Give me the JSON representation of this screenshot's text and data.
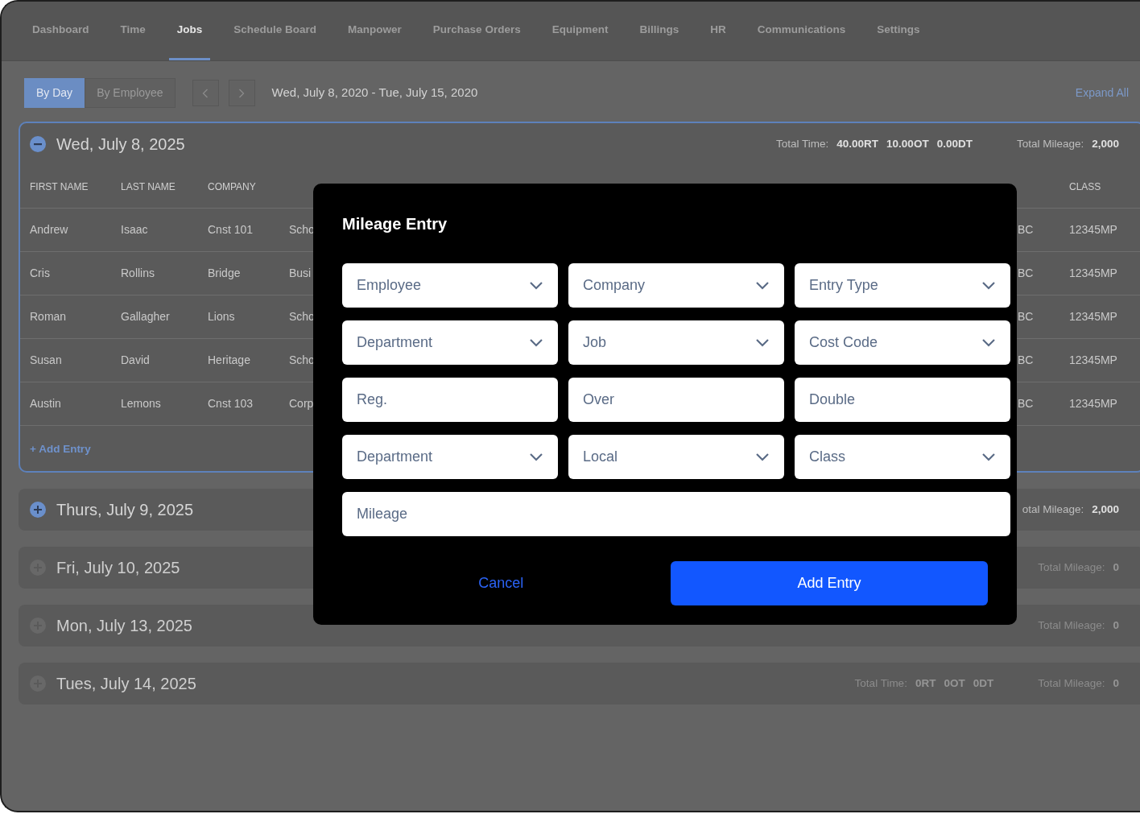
{
  "nav": [
    {
      "label": "Dashboard",
      "selected": false
    },
    {
      "label": "Time",
      "selected": false
    },
    {
      "label": "Jobs",
      "selected": true
    },
    {
      "label": "Schedule Board",
      "selected": false
    },
    {
      "label": "Manpower",
      "selected": false
    },
    {
      "label": "Purchase Orders",
      "selected": false
    },
    {
      "label": "Equipment",
      "selected": false
    },
    {
      "label": "Billings",
      "selected": false
    },
    {
      "label": "HR",
      "selected": false
    },
    {
      "label": "Communications",
      "selected": false
    },
    {
      "label": "Settings",
      "selected": false
    }
  ],
  "toolbar": {
    "views": [
      {
        "label": "By Day",
        "selected": true
      },
      {
        "label": "By Employee",
        "selected": false
      }
    ],
    "date_range": "Wed, July 8, 2020 - Tue, July 15, 2020",
    "expand_all": "Expand All"
  },
  "days": [
    {
      "title": "Wed, July 8, 2025",
      "expanded": true,
      "has_entries": true,
      "total_time": {
        "label": "Total Time:",
        "values": [
          "40.00RT",
          "10.00OT",
          "0.00DT"
        ]
      },
      "total_mileage": {
        "label": "Total Mileage:",
        "value": "2,000"
      },
      "columns": [
        "FIRST NAME",
        "LAST NAME",
        "COMPANY",
        "",
        "",
        "CLASS"
      ],
      "rows": [
        [
          "Andrew",
          "Isaac",
          "Cnst 101",
          "Scho",
          "BC",
          "12345MP"
        ],
        [
          "Cris",
          "Rollins",
          "Bridge",
          "Busi",
          "BC",
          "12345MP"
        ],
        [
          "Roman",
          "Gallagher",
          "Lions",
          "Scho",
          "BC",
          "12345MP"
        ],
        [
          "Susan",
          "David",
          "Heritage",
          "Scho",
          "BC",
          "12345MP"
        ],
        [
          "Austin",
          "Lemons",
          "Cnst 103",
          "Corp",
          "BC",
          "12345MP"
        ]
      ],
      "add_entry": "+ Add Entry"
    },
    {
      "title": "Thurs, July 9, 2025",
      "expanded": false,
      "has_entries": true,
      "total_mileage": {
        "label": "otal Mileage:",
        "value": "2,000"
      }
    },
    {
      "title": "Fri, July 10, 2025",
      "expanded": false,
      "has_entries": false,
      "total_mileage": {
        "label": "Total Mileage:",
        "value": "0"
      }
    },
    {
      "title": "Mon, July 13, 2025",
      "expanded": false,
      "has_entries": false,
      "total_mileage": {
        "label": "Total Mileage:",
        "value": "0"
      }
    },
    {
      "title": "Tues, July 14, 2025",
      "expanded": false,
      "has_entries": false,
      "total_time": {
        "label": "Total Time:",
        "values": [
          "0RT",
          "0OT",
          "0DT"
        ]
      },
      "total_mileage": {
        "label": "Total Mileage:",
        "value": "0"
      }
    }
  ],
  "modal": {
    "title": "Mileage Entry",
    "fields": [
      {
        "kind": "select",
        "placeholder": "Employee",
        "full_width": false
      },
      {
        "kind": "select",
        "placeholder": "Company",
        "full_width": false
      },
      {
        "kind": "select",
        "placeholder": "Entry Type",
        "full_width": false
      },
      {
        "kind": "select",
        "placeholder": "Department",
        "full_width": false
      },
      {
        "kind": "select",
        "placeholder": "Job",
        "full_width": false
      },
      {
        "kind": "select",
        "placeholder": "Cost Code",
        "full_width": false
      },
      {
        "kind": "text",
        "placeholder": "Reg.",
        "full_width": false
      },
      {
        "kind": "text",
        "placeholder": "Over",
        "full_width": false
      },
      {
        "kind": "text",
        "placeholder": "Double",
        "full_width": false
      },
      {
        "kind": "select",
        "placeholder": "Department",
        "full_width": false
      },
      {
        "kind": "select",
        "placeholder": "Local",
        "full_width": false
      },
      {
        "kind": "select",
        "placeholder": "Class",
        "full_width": false
      },
      {
        "kind": "text",
        "placeholder": "Mileage",
        "full_width": true
      }
    ],
    "cancel": "Cancel",
    "submit": "Add Entry"
  }
}
